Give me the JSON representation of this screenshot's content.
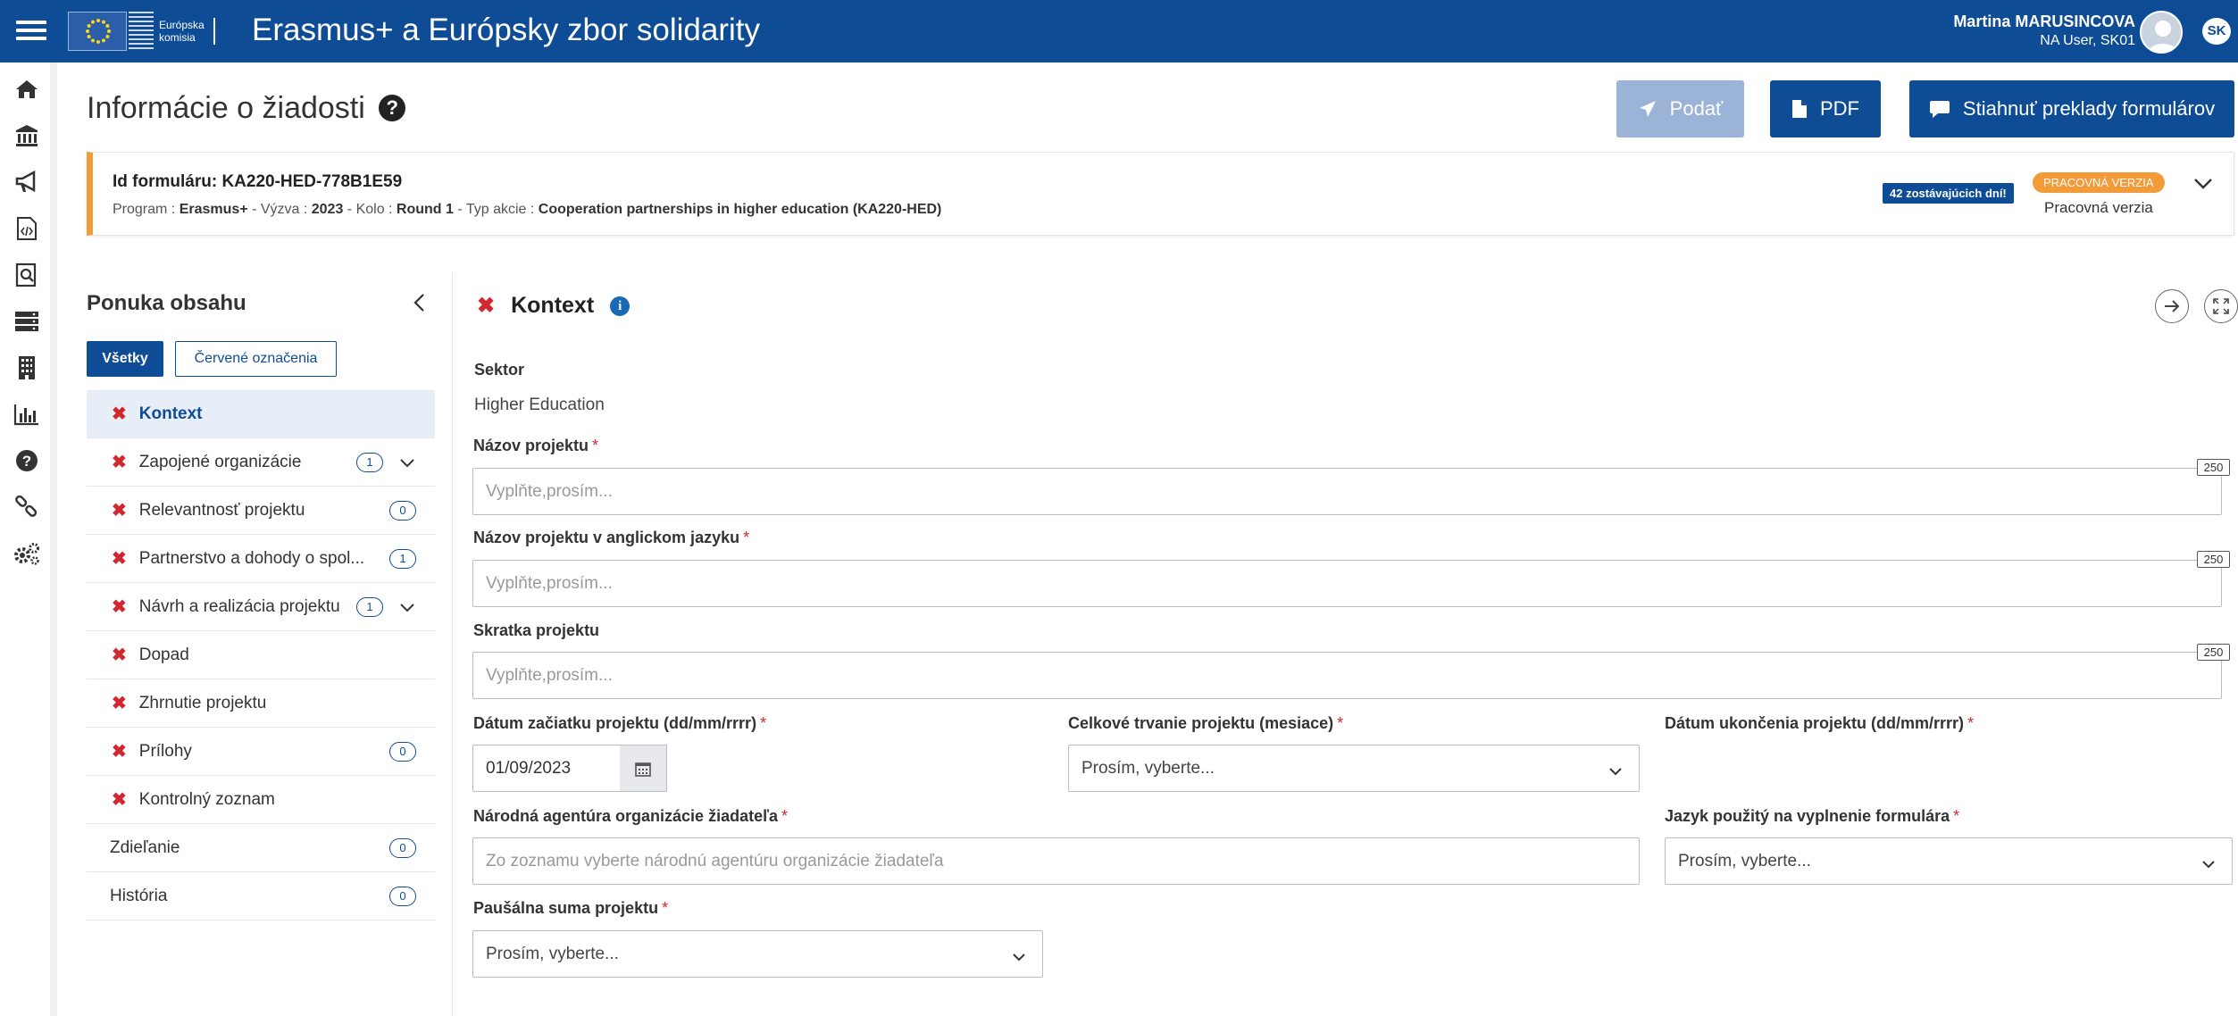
{
  "header": {
    "logo_line1": "Európska",
    "logo_line2": "komisia",
    "app_title": "Erasmus+ a Európsky zbor solidarity",
    "user_name": "Martina MARUSINCOVA",
    "user_role": "NA User, SK01",
    "language": "SK"
  },
  "rail": {
    "icons": [
      "home-icon",
      "institution-icon",
      "megaphone-icon",
      "code-file-icon",
      "search-document-icon",
      "server-icon",
      "building-icon",
      "bar-chart-icon",
      "help-icon",
      "links-icon",
      "settings-icon"
    ]
  },
  "page": {
    "title": "Informácie o žiadosti",
    "title_help": "?",
    "buttons": {
      "submit": "Podať",
      "pdf": "PDF",
      "download_translations": "Stiahnuť preklady formulárov"
    }
  },
  "info_card": {
    "form_id_label": "Id formuláru: KA220-HED-778B1E59",
    "program_label": "Program : ",
    "program": "Erasmus+",
    "call_label": " - Výzva : ",
    "call": "2023",
    "round_label": " - Kolo : ",
    "round": "Round 1",
    "action_label": " - Typ akcie : ",
    "action": "Cooperation partnerships in higher education (KA220-HED)",
    "days_left": "42 zostávajúcich dní!",
    "status_badge": "PRACOVNÁ VERZIA",
    "status_text": "Pracovná verzia"
  },
  "sidebar": {
    "title": "Ponuka obsahu",
    "tab_all": "Všetky",
    "tab_red": "Červené označenia",
    "items": [
      {
        "label": "Kontext",
        "error": "✖"
      },
      {
        "label": "Zapojené organizácie",
        "error": "✖",
        "count": "1"
      },
      {
        "label": "Relevantnosť projektu",
        "error": "✖",
        "count": "0"
      },
      {
        "label": "Partnerstvo a dohody o spol...",
        "error": "✖",
        "count": "1"
      },
      {
        "label": "Návrh a realizácia projektu",
        "error": "✖",
        "count": "1"
      },
      {
        "label": "Dopad",
        "error": "✖"
      },
      {
        "label": "Zhrnutie projektu",
        "error": "✖"
      },
      {
        "label": "Prílohy",
        "error": "✖",
        "count": "0"
      },
      {
        "label": "Kontrolný zoznam",
        "error": "✖"
      },
      {
        "label": "Zdieľanie",
        "count": "0"
      },
      {
        "label": "História",
        "count": "0"
      }
    ]
  },
  "form": {
    "section_title": "Kontext",
    "section_error": "✖",
    "sector_label": "Sektor",
    "sector_value": "Higher Education",
    "required_mark": "*",
    "project_name_label": "Názov projektu",
    "project_name_placeholder": "Vyplňte,prosím...",
    "project_name_counter": "250",
    "project_name_en_label": "Názov projektu v anglickom jazyku",
    "project_name_en_placeholder": "Vyplňte,prosím...",
    "project_name_en_counter": "250",
    "acronym_label": "Skratka projektu",
    "acronym_placeholder": "Vyplňte,prosím...",
    "acronym_counter": "250",
    "start_date_label": "Dátum začiatku projektu (dd/mm/rrrr)",
    "start_date_value": "01/09/2023",
    "duration_label": "Celkové trvanie projektu (mesiace)",
    "duration_value": "Prosím, vyberte...",
    "end_date_label": "Dátum ukončenia projektu (dd/mm/rrrr)",
    "agency_label": "Národná agentúra organizácie žiadateľa",
    "agency_placeholder": "Zo zoznamu vyberte národnú agentúru organizácie žiadateľa",
    "language_label": "Jazyk použitý na vyplnenie formulára",
    "language_value": "Prosím, vyberte...",
    "lump_sum_label": "Paušálna suma projektu",
    "lump_sum_value": "Prosím, vyberte..."
  }
}
